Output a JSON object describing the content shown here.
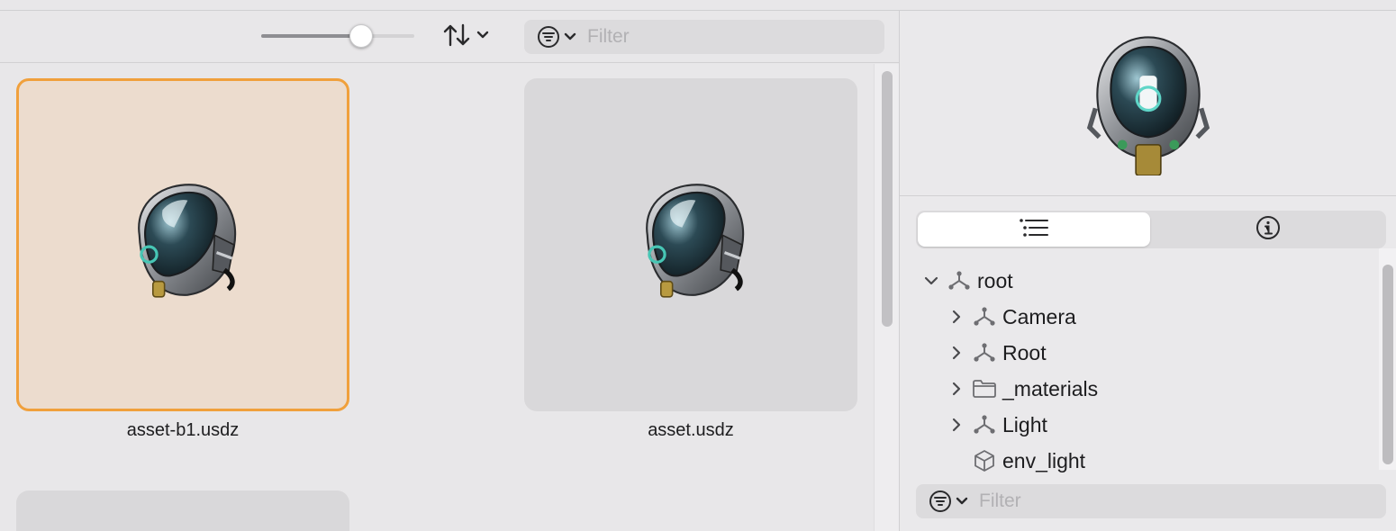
{
  "toolbar": {
    "size_slider_value": 0.65,
    "sort_icon": "sort-arrows-icon",
    "filter_icon": "filter-menu-icon",
    "filter_placeholder": "Filter"
  },
  "assets": [
    {
      "name": "asset-b1.usdz",
      "selected": true,
      "thumbnail": "helmet-thumbnail"
    },
    {
      "name": "asset.usdz",
      "selected": false,
      "thumbnail": "helmet-thumbnail"
    },
    {
      "name": "",
      "selected": false,
      "thumbnail": ""
    }
  ],
  "inspector": {
    "preview": "helmet-preview",
    "tabs": [
      {
        "icon": "list-icon",
        "active": true
      },
      {
        "icon": "info-icon",
        "active": false
      }
    ],
    "tree": [
      {
        "label": "root",
        "expanded": true,
        "icon": "transform-node-icon",
        "level": 0
      },
      {
        "label": "Camera",
        "expanded": false,
        "icon": "transform-node-icon",
        "level": 1
      },
      {
        "label": "Root",
        "expanded": false,
        "icon": "transform-node-icon",
        "level": 1
      },
      {
        "label": "_materials",
        "expanded": false,
        "icon": "folder-icon",
        "level": 1
      },
      {
        "label": "Light",
        "expanded": false,
        "icon": "transform-node-icon",
        "level": 1
      },
      {
        "label": "env_light",
        "expanded": null,
        "icon": "cube-icon",
        "level": 1
      }
    ],
    "filter_placeholder": "Filter"
  },
  "colors": {
    "selection_border": "#f0a03c",
    "selection_fill": "#ecdcce",
    "background": "#e8e7e9"
  }
}
